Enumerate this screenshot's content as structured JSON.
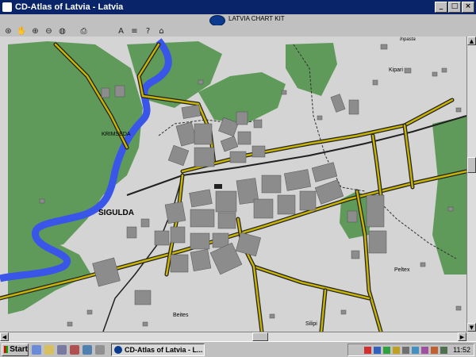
{
  "window": {
    "title": "CD-Atlas of Latvia - Latvia",
    "minimize": "_",
    "maximize": "□",
    "close": "×"
  },
  "brand": {
    "text": "LATVIA CHART KIT"
  },
  "toolbar": {
    "icons": [
      "pan-icon",
      "hand-icon",
      "zoom-in-icon",
      "zoom-out-icon",
      "globe-icon",
      "print-icon",
      "text-icon",
      "layers-icon",
      "help-icon",
      "home-icon"
    ],
    "glyphs": [
      "⊛",
      "✋",
      "⊕",
      "⊖",
      "◍",
      "⎙",
      "A",
      "≡",
      "?",
      "⌂"
    ]
  },
  "map": {
    "labels": {
      "kiparl": "Kipari",
      "krimseda": "KRIMSEDA",
      "sigulda": "SIGULDA",
      "peltex": "Peltex",
      "beites": "Beites",
      "silipi": "Silipi",
      "inpasta": "Inpasta"
    },
    "colors": {
      "background": "#d4d4d4",
      "forest": "#5f9a5a",
      "river": "#3a56e8",
      "road_fill": "#c8b400",
      "road_edge": "#202020",
      "building": "#8c8c8c"
    }
  },
  "taskbar": {
    "start": "Start",
    "task": "CD-Atlas of Latvia - L...",
    "clock": "11:52"
  }
}
